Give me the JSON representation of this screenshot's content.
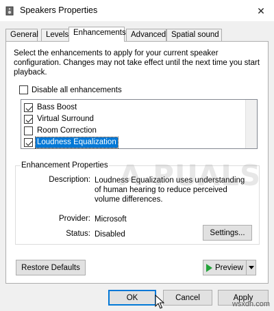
{
  "window": {
    "title": "Speakers Properties",
    "close_glyph": "✕"
  },
  "tabs": [
    {
      "label": "General"
    },
    {
      "label": "Levels"
    },
    {
      "label": "Enhancements",
      "active": true
    },
    {
      "label": "Advanced"
    },
    {
      "label": "Spatial sound"
    }
  ],
  "enhancements": {
    "description": "Select the enhancements to apply for your current speaker configuration. Changes may not take effect until the next time you start playback.",
    "disable_all": {
      "label": "Disable all enhancements",
      "checked": false
    },
    "items": [
      {
        "label": "Bass Boost",
        "checked": true
      },
      {
        "label": "Virtual Surround",
        "checked": true
      },
      {
        "label": "Room Correction",
        "checked": false
      },
      {
        "label": "Loudness Equalization",
        "checked": true,
        "selected": true
      }
    ]
  },
  "properties": {
    "legend": "Enhancement Properties",
    "description_label": "Description:",
    "description_value": "Loudness Equalization uses understanding of human hearing to reduce perceived volume differences.",
    "provider_label": "Provider:",
    "provider_value": "Microsoft",
    "status_label": "Status:",
    "status_value": "Disabled",
    "settings_button": "Settings..."
  },
  "buttons": {
    "restore_defaults": "Restore Defaults",
    "preview": "Preview",
    "ok": "OK",
    "cancel": "Cancel",
    "apply": "Apply"
  },
  "watermark": {
    "appuals": "A  PUALS",
    "site": "wsxdn.com"
  },
  "colors": {
    "selection": "#0078d7",
    "play": "#23a33a"
  }
}
